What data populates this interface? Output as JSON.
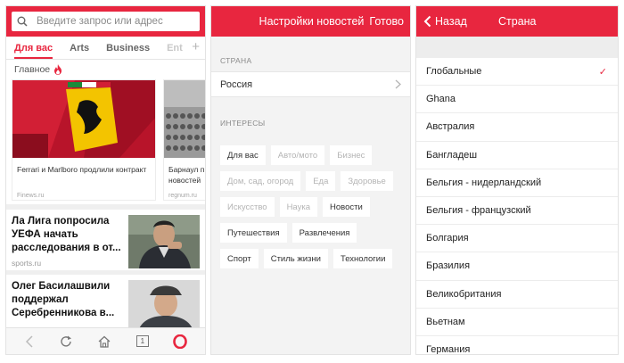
{
  "panel_feed": {
    "search_placeholder": "Введите запрос или адрес",
    "tabs": [
      {
        "label": "Для вас"
      },
      {
        "label": "Arts"
      },
      {
        "label": "Business"
      },
      {
        "label": "Ent"
      }
    ],
    "section_label": "Главное",
    "cards": [
      {
        "title": "Ferrari и Marlboro продлили контракт",
        "source": "Finews.ru"
      },
      {
        "title": "Барнаул п новостей",
        "source": "regnum.ru"
      }
    ],
    "stories": [
      {
        "title": "Ла Лига попросила УЕФА начать расследования в от...",
        "source": "sports.ru"
      },
      {
        "title": "Олег Басилашвили поддержал Серебренникова в...",
        "source": ""
      }
    ],
    "tabs_count": "1",
    "colors": {
      "accent": "#e8263f"
    }
  },
  "panel_settings": {
    "title": "Настройки новостей",
    "done_label": "Готово",
    "country_section": "СТРАНА",
    "country_value": "Россия",
    "interests_section": "ИНТЕРЕСЫ",
    "chip_rows": [
      [
        {
          "label": "Для вас",
          "on": true
        },
        {
          "label": "Авто/мото",
          "on": false
        },
        {
          "label": "Бизнес",
          "on": false
        }
      ],
      [
        {
          "label": "Дом, сад, огород",
          "on": false
        },
        {
          "label": "Еда",
          "on": false
        },
        {
          "label": "Здоровье",
          "on": false
        }
      ],
      [
        {
          "label": "Искусство",
          "on": false
        },
        {
          "label": "Наука",
          "on": false
        },
        {
          "label": "Новости",
          "on": true
        }
      ],
      [
        {
          "label": "Путешествия",
          "on": true
        },
        {
          "label": "Развлечения",
          "on": true
        }
      ],
      [
        {
          "label": "Спорт",
          "on": true
        },
        {
          "label": "Стиль жизни",
          "on": true
        },
        {
          "label": "Технологии",
          "on": true
        }
      ]
    ]
  },
  "panel_country": {
    "back_label": "Назад",
    "title": "Страна",
    "countries": [
      {
        "name": "Глобальные",
        "selected": true
      },
      {
        "name": "Ghana",
        "selected": false
      },
      {
        "name": "Австралия",
        "selected": false
      },
      {
        "name": "Бангладеш",
        "selected": false
      },
      {
        "name": "Бельгия - нидерландский",
        "selected": false
      },
      {
        "name": "Бельгия - французский",
        "selected": false
      },
      {
        "name": "Болгария",
        "selected": false
      },
      {
        "name": "Бразилия",
        "selected": false
      },
      {
        "name": "Великобритания",
        "selected": false
      },
      {
        "name": "Вьетнам",
        "selected": false
      },
      {
        "name": "Германия",
        "selected": false
      }
    ],
    "check_glyph": "✓"
  }
}
